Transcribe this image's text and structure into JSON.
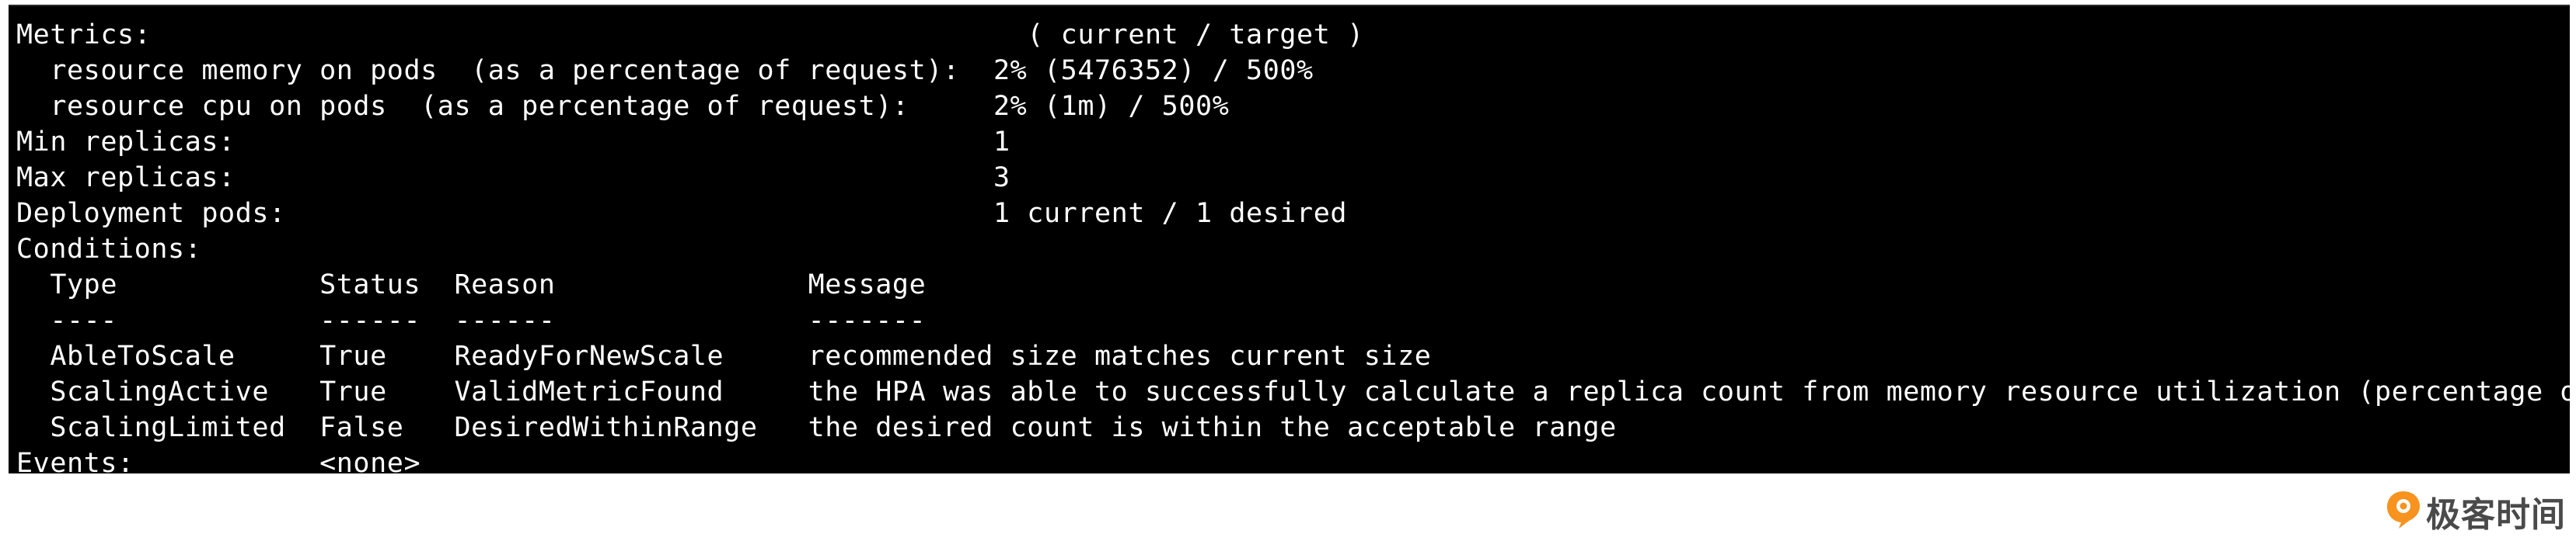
{
  "terminal": {
    "lines": [
      "Metrics:                                                    ( current / target )",
      "  resource memory on pods  (as a percentage of request):  2% (5476352) / 500%",
      "  resource cpu on pods  (as a percentage of request):     2% (1m) / 500%",
      "Min replicas:                                             1",
      "Max replicas:                                             3",
      "Deployment pods:                                          1 current / 1 desired",
      "Conditions:",
      "  Type            Status  Reason               Message",
      "  ----            ------  ------               -------",
      "  AbleToScale     True    ReadyForNewScale     recommended size matches current size",
      "  ScalingActive   True    ValidMetricFound     the HPA was able to successfully calculate a replica count from memory resource utilization (percentage of request)",
      "  ScalingLimited  False   DesiredWithinRange   the desired count is within the acceptable range",
      "Events:           <none>"
    ]
  },
  "watermark": {
    "text": "极客时间",
    "icon": "geektime-logo-icon",
    "color": "#f7931e"
  }
}
